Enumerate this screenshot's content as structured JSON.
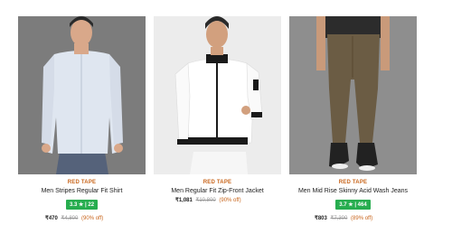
{
  "products": [
    {
      "brand": "RED TAPE",
      "title": "Men Stripes Regular Fit Shirt",
      "rating": "3.3 ★ | 22",
      "price": "₹470",
      "mrp": "₹4,800",
      "discount": "(90% off)"
    },
    {
      "brand": "RED TAPE",
      "title": "Men Regular Fit Zip-Front Jacket",
      "rating": "",
      "price": "₹1,081",
      "mrp": "₹10,800",
      "discount": "(90% off)"
    },
    {
      "brand": "RED TAPE",
      "title": "Men Mid Rise Skinny Acid Wash Jeans",
      "rating": "3.7 ★ | 464",
      "price": "₹803",
      "mrp": "₹7,300",
      "discount": "(89% off)"
    }
  ],
  "colors": {
    "brand": "#c8651b",
    "rating_bg": "#27ad4f"
  }
}
